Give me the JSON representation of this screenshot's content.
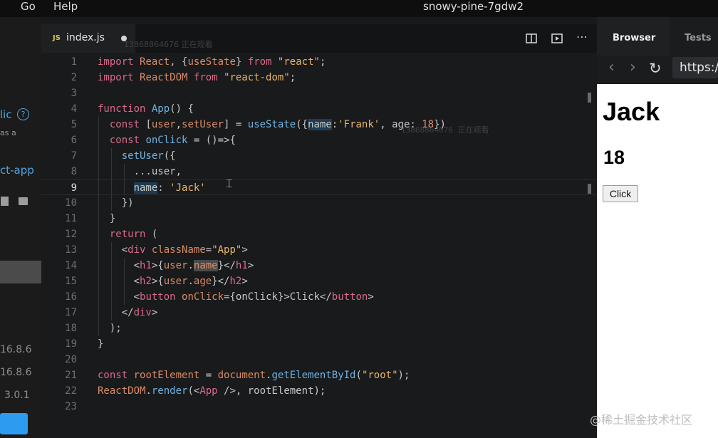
{
  "menubar": {
    "items": [
      "Go",
      "Help"
    ],
    "title": "snowy-pine-7gdw2"
  },
  "sidebar": {
    "texts": [
      "lic",
      "as a",
      "ct-app",
      "16.8.6",
      "16.8.6",
      "3.0.1"
    ]
  },
  "editor": {
    "tab": {
      "badge": "JS",
      "filename": "index.js"
    },
    "watermark_text": "13868864676 正在观看",
    "lines": [
      {
        "n": "1",
        "html": "<span class='kw'>import</span> <span class='attr'>React</span>, {<span class='attr'>useState</span>} <span class='kw'>from</span> <span class='str'>\"react\"</span>;"
      },
      {
        "n": "2",
        "html": "<span class='kw'>import</span> <span class='attr'>ReactDOM</span> <span class='kw'>from</span> <span class='str'>\"react-dom\"</span>;"
      },
      {
        "n": "3",
        "html": ""
      },
      {
        "n": "4",
        "html": "<span class='kw'>function</span> <span class='fn'>App</span>() {"
      },
      {
        "n": "5",
        "html": "  <span class='kw'>const</span> [<span class='attr'>user</span>,<span class='attr'>setUser</span>] = <span class='fn'>useState</span>({<span class='hl-sel'>name</span>:<span class='str'>'Frank'</span>, age: <span class='num'>18</span>})"
      },
      {
        "n": "6",
        "html": "  <span class='kw'>const</span> <span class='fn'>onClick</span> = ()=>{"
      },
      {
        "n": "7",
        "html": "    <span class='fn'>setUser</span>({"
      },
      {
        "n": "8",
        "html": "      ...user,"
      },
      {
        "n": "9",
        "html": "      <span class='hl-sel'>name</span>: <span class='str'>'Jack'</span>"
      },
      {
        "n": "10",
        "html": "    })"
      },
      {
        "n": "11",
        "html": "  }"
      },
      {
        "n": "12",
        "html": "  <span class='kw'>return</span> ("
      },
      {
        "n": "13",
        "html": "    &lt;<span class='tag'>div</span> <span class='attr'>className</span>=<span class='str'>\"App\"</span>&gt;"
      },
      {
        "n": "14",
        "html": "      &lt;<span class='tag'>h1</span>&gt;{<span class='attr'>user</span>.<span class='hl-grey'><span class='attr'>name</span></span>}&lt;/<span class='tag'>h1</span>&gt;"
      },
      {
        "n": "15",
        "html": "      &lt;<span class='tag'>h2</span>&gt;{<span class='attr'>user</span>.<span class='attr'>age</span>}&lt;/<span class='tag'>h2</span>&gt;"
      },
      {
        "n": "16",
        "html": "      &lt;<span class='tag'>button</span> <span class='attr'>onClick</span>={onClick}&gt;Click&lt;/<span class='tag'>button</span>&gt;"
      },
      {
        "n": "17",
        "html": "    &lt;/<span class='tag'>div</span>&gt;"
      },
      {
        "n": "18",
        "html": "  );"
      },
      {
        "n": "19",
        "html": "}"
      },
      {
        "n": "20",
        "html": ""
      },
      {
        "n": "21",
        "html": "<span class='kw'>const</span> <span class='attr'>rootElement</span> = <span class='attr'>document</span>.<span class='fn'>getElementById</span>(<span class='str'>\"root\"</span>);"
      },
      {
        "n": "22",
        "html": "<span class='attr'>ReactDOM</span>.<span class='fn'>render</span>(&lt;<span class='tag'>App</span> /&gt;, rootElement);"
      },
      {
        "n": "23",
        "html": ""
      }
    ],
    "current_line": "9"
  },
  "right": {
    "tabs": [
      "Browser",
      "Tests"
    ],
    "url": "https:/",
    "preview": {
      "h1": "Jack",
      "h2": "18",
      "button": "Click"
    }
  },
  "brand_watermark": "@稀土掘金技术社区",
  "colors": {
    "keyword": "#d96a8a",
    "function": "#6fb3e0",
    "string": "#e8b56b",
    "selection": "#1f3b52"
  }
}
